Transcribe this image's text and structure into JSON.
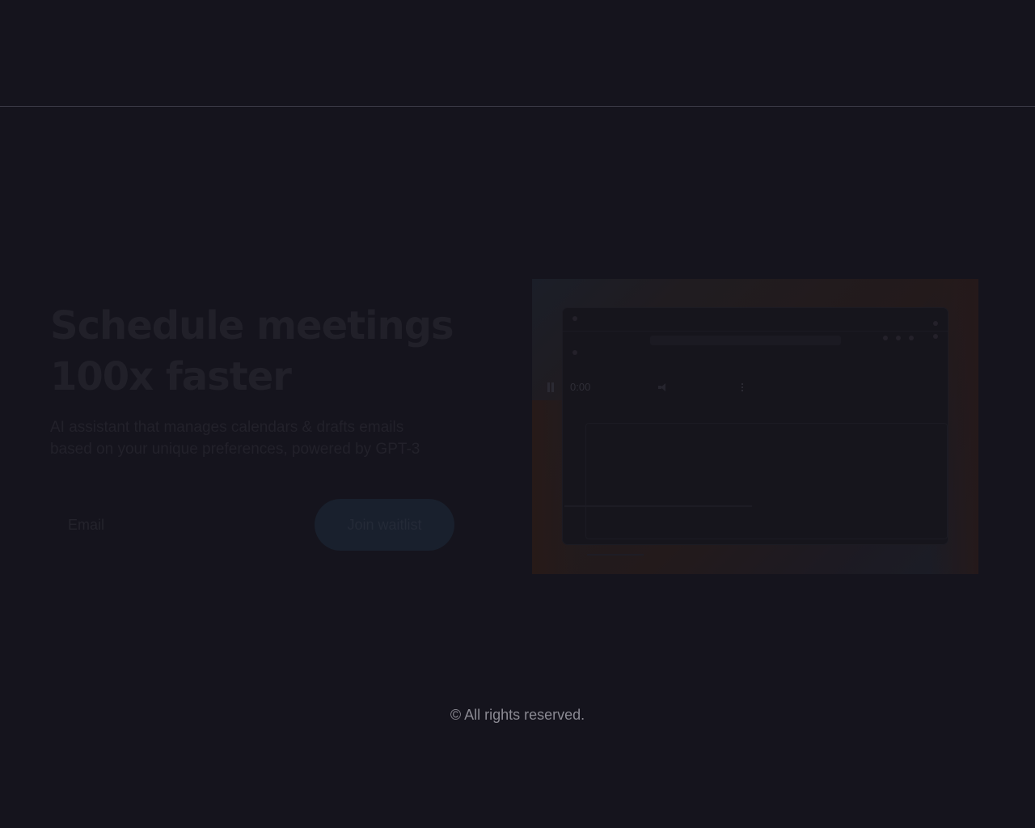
{
  "hero": {
    "title_line1": "Schedule meetings",
    "title_line2": "100x faster",
    "subtitle_line1": "AI assistant that manages calendars & drafts emails",
    "subtitle_line2": "based on your unique preferences, powered by GPT-3"
  },
  "waitlist": {
    "email_placeholder": "Email",
    "join_label": "Join waitlist"
  },
  "video": {
    "time": "0:00"
  },
  "footer": {
    "copyright": "© All rights reserved."
  },
  "colors": {
    "background": "#15141d",
    "divider": "#3d3c48",
    "footer_text": "#8b8a93"
  }
}
